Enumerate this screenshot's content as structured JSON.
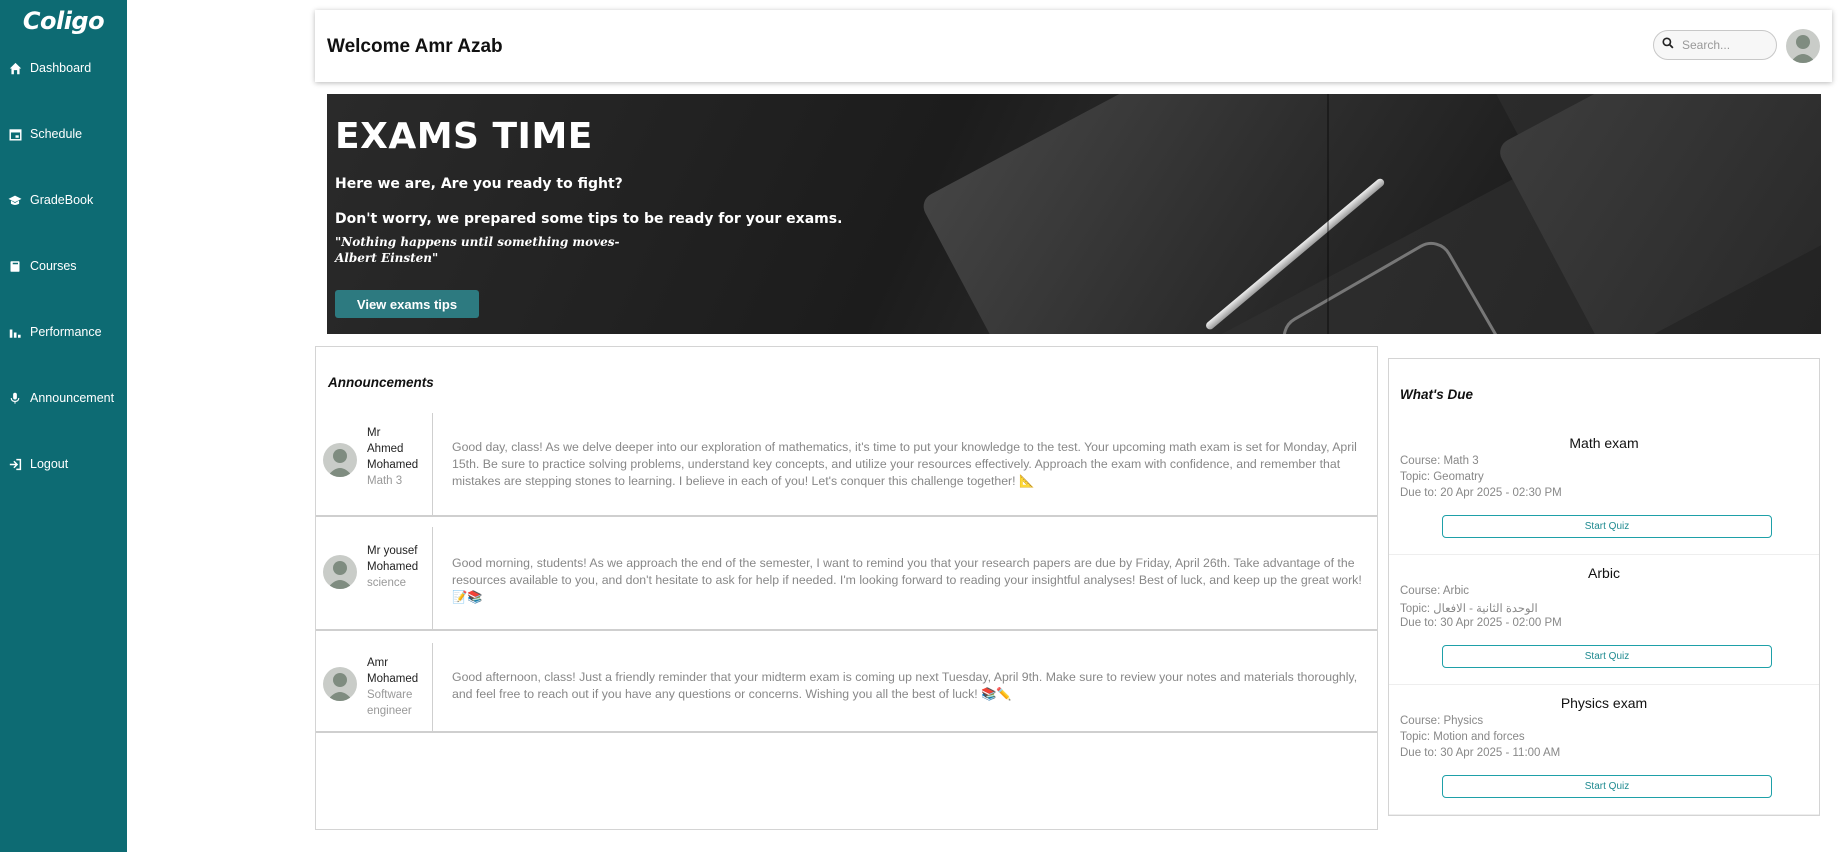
{
  "sidebar": {
    "logo": "Coligo",
    "items": [
      {
        "label": "Dashboard",
        "icon": "home-icon"
      },
      {
        "label": "Schedule",
        "icon": "calendar-icon"
      },
      {
        "label": "GradeBook",
        "icon": "graduation-cap-icon"
      },
      {
        "label": "Courses",
        "icon": "book-icon"
      },
      {
        "label": "Performance",
        "icon": "bar-chart-icon"
      },
      {
        "label": "Announcement",
        "icon": "microphone-icon"
      },
      {
        "label": "Logout",
        "icon": "logout-icon"
      }
    ],
    "color": "#0d6b73"
  },
  "header": {
    "welcome": "Welcome Amr Azab",
    "search_placeholder": "Search..."
  },
  "banner": {
    "title": "EXAMS TIME",
    "line1": "Here we are, Are you ready to fight?",
    "line2": "Don't worry, we prepared some tips to be ready for your exams.",
    "quote_line1": "\"Nothing happens until something moves-",
    "quote_line2": "Albert Einsten\"",
    "button": "View exams tips"
  },
  "announcements": {
    "title": "Announcements",
    "items": [
      {
        "name_line1": "Mr",
        "name_line2": "Ahmed",
        "name_line3": "Mohamed",
        "subject": "Math 3",
        "message": "Good day, class! As we delve deeper into our exploration of mathematics, it's time to put your knowledge to the test. Your upcoming math exam is set for Monday, April 15th. Be sure to practice solving problems, understand key concepts, and utilize your resources effectively. Approach the exam with confidence, and remember that mistakes are stepping stones to learning. I believe in each of you! Let's conquer this challenge together! 📐"
      },
      {
        "name_line1": "Mr yousef",
        "name_line2": "Mohamed",
        "subject": "science",
        "message": "Good morning, students! As we approach the end of the semester, I want to remind you that your research papers are due by Friday, April 26th. Take advantage of the resources available to you, and don't hesitate to ask for help if needed. I'm looking forward to reading your insightful analyses! Best of luck, and keep up the great work! 📝📚"
      },
      {
        "name_line1": "Amr",
        "name_line2": "Mohamed",
        "subject_line1": "Software",
        "subject_line2": "engineer",
        "message": "Good afternoon, class! Just a friendly reminder that your midterm exam is coming up next Tuesday, April 9th. Make sure to review your notes and materials thoroughly, and feel free to reach out if you have any questions or concerns. Wishing you all the best of luck! 📚✏️"
      }
    ]
  },
  "due": {
    "title": "What's Due",
    "items": [
      {
        "title": "Math exam",
        "course": "Course: Math 3",
        "topic": "Topic: Geomatry",
        "due": "Due to: 20 Apr 2025 - 02:30 PM",
        "button": "Start Quiz"
      },
      {
        "title": "Arbic",
        "course": "Course: Arbic",
        "topic": "Topic: الوحدة الثانية - الافعال",
        "due": "Due to: 30 Apr 2025 - 02:00 PM",
        "button": "Start Quiz"
      },
      {
        "title": "Physics exam",
        "course": "Course: Physics",
        "topic": "Topic: Motion and forces",
        "due": "Due to: 30 Apr 2025 - 11:00 AM",
        "button": "Start Quiz"
      }
    ],
    "accent": "#1ea0a8"
  }
}
